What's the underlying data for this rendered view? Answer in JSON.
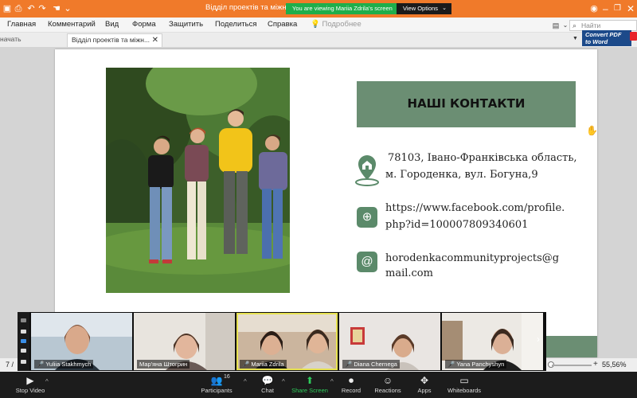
{
  "titlebar": {
    "title": "Відділ проектів та міжнарод",
    "share_banner": "You are viewing Mariia Zdrila's screen",
    "view_options": "View Options",
    "minimize": "–",
    "restore": "❐",
    "close": "✕"
  },
  "menu": {
    "items": [
      "Главная",
      "Комментарий",
      "Вид",
      "Форма",
      "Защитить",
      "Поделиться",
      "Справка"
    ],
    "help_hint": "Подробнее",
    "search_placeholder": "Найти"
  },
  "tabs": {
    "prev_fragment": "начать",
    "active": "Відділ проектів та міжн...",
    "convert_label": "Convert PDF to Word"
  },
  "slide": {
    "heading": "НАШІ КОНТАКТИ",
    "address_line1": "78103, Івано-Франківська область,",
    "address_line2": "м. Городенка, вул. Богуна,9",
    "facebook_line1": "https://www.facebook.com/profile.",
    "facebook_line2": "php?id=100007809340601",
    "email_line1": "horodenkacommunityprojects@g",
    "email_line2": "mail.com",
    "accent_color": "#6b8e73"
  },
  "participants": [
    {
      "name": "Yuliia Stakhmych",
      "muted": true
    },
    {
      "name": "Мар'яна Штогрин",
      "muted": false
    },
    {
      "name": "Mariia Zdrila",
      "muted": true,
      "active": true
    },
    {
      "name": "Diana Chernega",
      "muted": true
    },
    {
      "name": "Yana Panchyshyn",
      "muted": true
    }
  ],
  "status": {
    "page": "7 /",
    "zoom": "55,56%",
    "zoom_fraction": 0.1
  },
  "toolbar": {
    "stop_video": "Stop Video",
    "participants": "Participants",
    "participants_count": "16",
    "chat": "Chat",
    "share_screen": "Share Screen",
    "record": "Record",
    "reactions": "Reactions",
    "apps": "Apps",
    "whiteboards": "Whiteboards"
  }
}
